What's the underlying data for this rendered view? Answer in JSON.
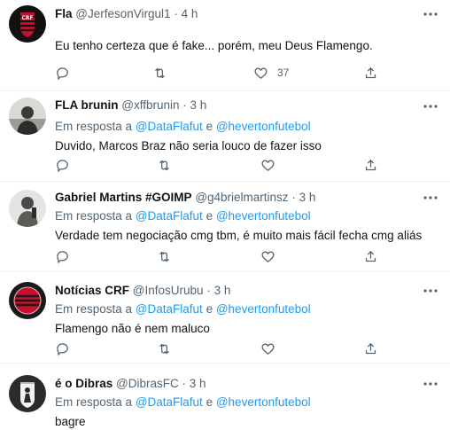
{
  "tweets": [
    {
      "name": "Fla",
      "handle": "@JerfesonVirgul1",
      "time": "4 h",
      "reply_prefix": "",
      "reply_to": [],
      "text": "Eu tenho certeza que é fake... porém, meu Deus Flamengo.",
      "likes": "37",
      "avatar": "flamengo-crest-avatar"
    },
    {
      "name": "FLA brunin",
      "handle": "@xffbrunin",
      "time": "3 h",
      "reply_prefix": "Em resposta a",
      "reply_to": [
        "@DataFlafut",
        "@hevertonfutebol"
      ],
      "reply_joiner": "e",
      "text": "Duvido, Marcos Braz não seria louco de fazer isso",
      "likes": "",
      "avatar": "person-photo-avatar"
    },
    {
      "name": "Gabriel Martins #GOIMP",
      "handle": "@g4brielmartinsz",
      "time": "3 h",
      "reply_prefix": "Em resposta a",
      "reply_to": [
        "@DataFlafut",
        "@hevertonfutebol"
      ],
      "reply_joiner": "e",
      "text": "Verdade tem negociação cmg tbm, é muito mais fácil fecha cmg aliás",
      "likes": "",
      "avatar": "person-photo-avatar"
    },
    {
      "name": "Notícias CRF",
      "handle": "@InfosUrubu",
      "time": "3 h",
      "reply_prefix": "Em resposta a",
      "reply_to": [
        "@DataFlafut",
        "@hevertonfutebol"
      ],
      "reply_joiner": "e",
      "text": "Flamengo não é nem maluco",
      "likes": "",
      "avatar": "flamengo-crest-avatar"
    },
    {
      "name": "é o Dibras",
      "handle": "@DibrasFC",
      "time": "3 h",
      "reply_prefix": "Em resposta a",
      "reply_to": [
        "@DataFlafut",
        "@hevertonfutebol"
      ],
      "reply_joiner": "e",
      "text": "bagre",
      "likes": "",
      "avatar": "badge-avatar"
    }
  ],
  "separator": "·",
  "icons": {
    "reply": "reply-icon",
    "retweet": "retweet-icon",
    "like": "heart-icon",
    "share": "share-icon",
    "more": "more-icon"
  },
  "colors": {
    "link": "#1d9bf0",
    "muted": "#536471",
    "text": "#0f1419",
    "divider": "#eff3f4"
  }
}
